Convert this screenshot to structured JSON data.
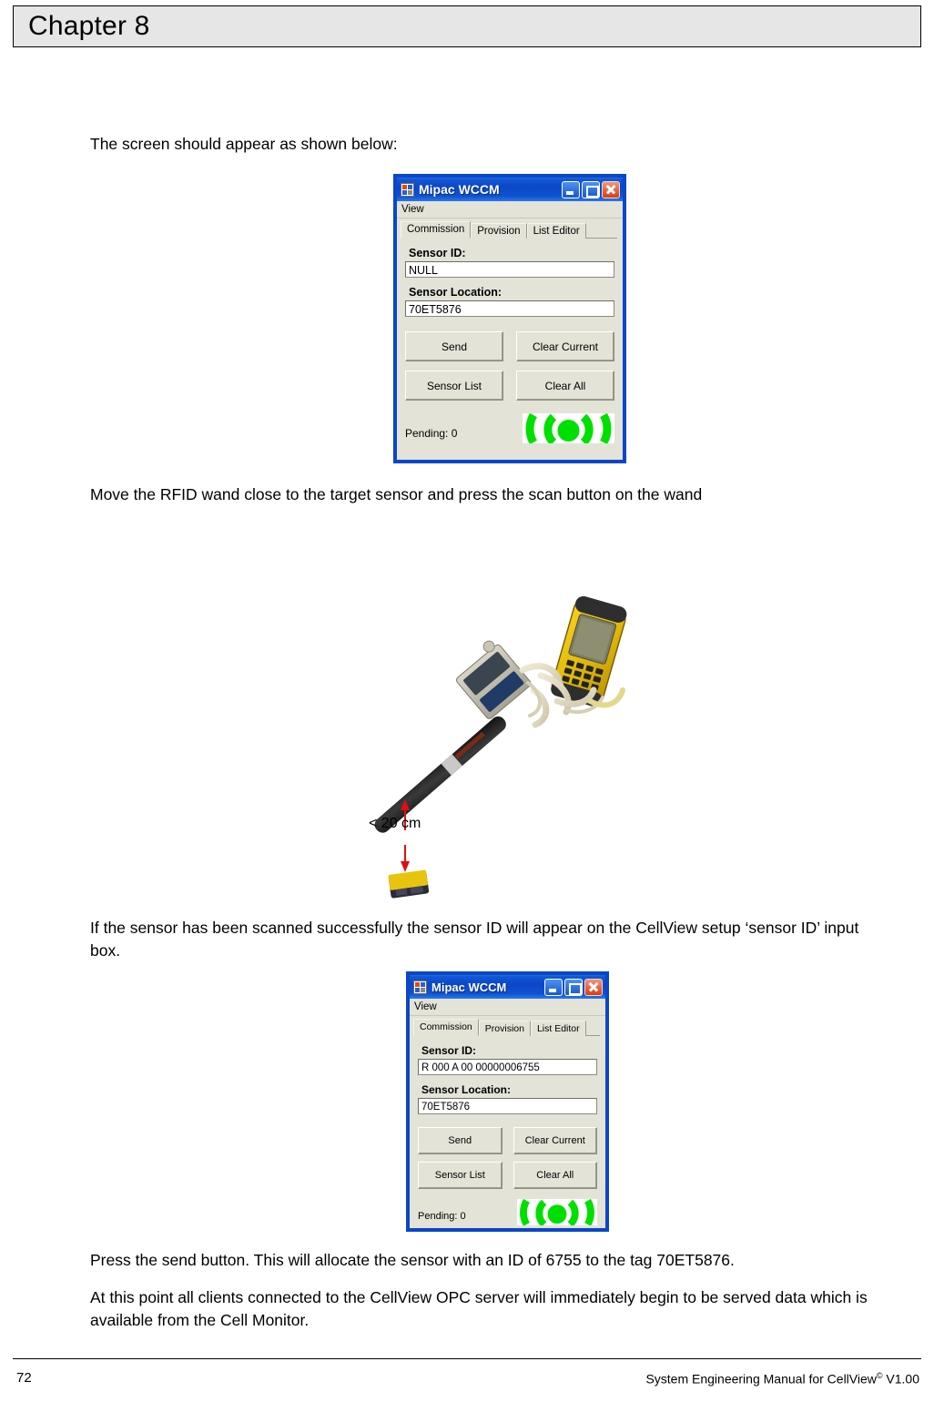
{
  "page": {
    "chapter_title": "Chapter 8"
  },
  "paragraphs": {
    "intro": "The screen should appear as shown below:",
    "move_wand": "Move the RFID wand close to the target sensor and press the scan button on the wand",
    "scanned": "If the sensor has been scanned successfully the sensor ID will appear on the CellView setup ‘sensor ID’ input box.",
    "press_send": "Press the send button. This will allocate the sensor with an ID of 6755 to the tag 70ET5876.",
    "opc_note": "At this point all clients connected to the CellView OPC server will immediately begin to be served data which is available from the Cell Monitor."
  },
  "figure": {
    "distance_label": "< 20 cm"
  },
  "dialog1": {
    "title": "Mipac WCCM",
    "menu": [
      "View"
    ],
    "tabs": [
      {
        "label": "Commission",
        "active": true
      },
      {
        "label": "Provision",
        "active": false
      },
      {
        "label": "List Editor",
        "active": false
      }
    ],
    "sensor_id_label": "Sensor ID:",
    "sensor_id_value": "NULL",
    "sensor_location_label": "Sensor Location:",
    "sensor_location_value": "70ET5876",
    "buttons": [
      "Send",
      "Clear Current",
      "Sensor List",
      "Clear All"
    ],
    "status": "Pending: 0",
    "logo": "rfid-wave-logo",
    "window_controls": [
      "minimize-button",
      "maximize-button",
      "close-button"
    ]
  },
  "dialog2": {
    "title": "Mipac WCCM",
    "menu": [
      "View"
    ],
    "tabs": [
      {
        "label": "Commission",
        "active": true
      },
      {
        "label": "Provision",
        "active": false
      },
      {
        "label": "List Editor",
        "active": false
      }
    ],
    "sensor_id_label": "Sensor ID:",
    "sensor_id_value": "R 000 A 00 00000006755",
    "sensor_location_label": "Sensor Location:",
    "sensor_location_value": "70ET5876",
    "buttons": [
      "Send",
      "Clear Current",
      "Sensor List",
      "Clear All"
    ],
    "status": "Pending: 0",
    "logo": "rfid-wave-logo",
    "window_controls": [
      "minimize-button",
      "maximize-button",
      "close-button"
    ]
  },
  "footer": {
    "page_number": "72",
    "manual_prefix": "System Engineering Manual for CellView",
    "manual_copyright": "©",
    "manual_version": " V1.00"
  },
  "colors": {
    "titlebar_blue": "#0b47c9",
    "dialog_face": "#e3e3d8",
    "close_red": "#d23f15",
    "logo_green": "#00e000",
    "header_grey": "#e6e6e6",
    "arrow_red": "#e01010"
  }
}
